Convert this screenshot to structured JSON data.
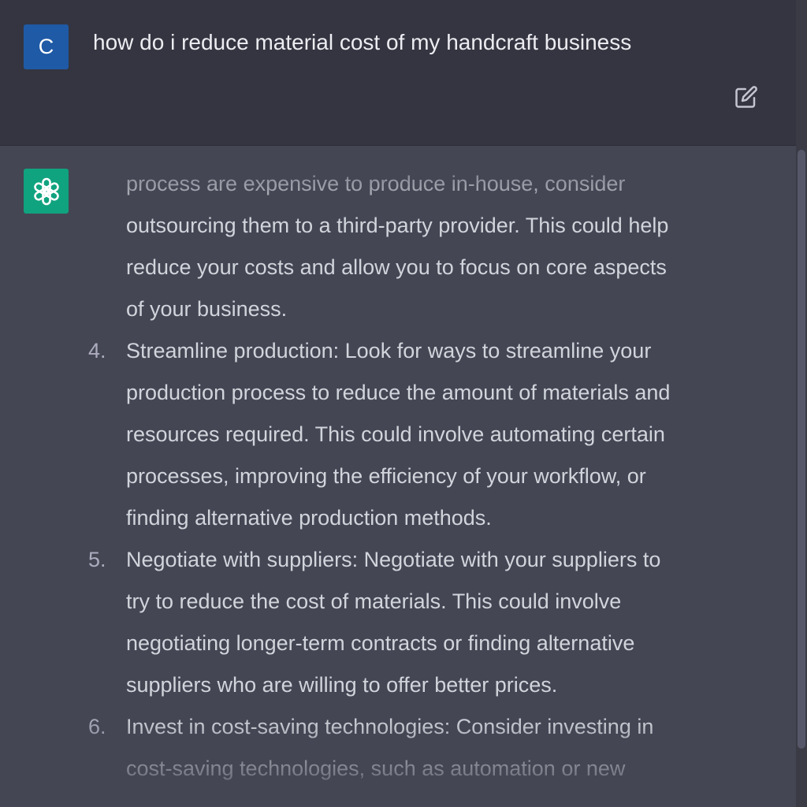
{
  "user": {
    "avatar_letter": "C",
    "message": "how do i reduce material cost of my handcraft business"
  },
  "icons": {
    "edit": "edit-icon",
    "assistant": "openai-logo-icon"
  },
  "colors": {
    "user_bg": "#343541",
    "assistant_bg": "#444654",
    "user_avatar": "#1f5aa6",
    "assistant_avatar": "#10a37f",
    "text": "#d1d5db"
  },
  "answer": {
    "continuation_lines": [
      "process are expensive to produce in-house, consider",
      "outsourcing them to a third-party provider. This could help",
      "reduce your costs and allow you to focus on core aspects",
      "of your business."
    ],
    "items": [
      {
        "number": "4.",
        "lines": [
          "Streamline production: Look for ways to streamline your",
          "production process to reduce the amount of materials and",
          "resources required. This could involve automating certain",
          "processes, improving the efficiency of your workflow, or",
          "finding alternative production methods."
        ]
      },
      {
        "number": "5.",
        "lines": [
          "Negotiate with suppliers: Negotiate with your suppliers to",
          "try to reduce the cost of materials. This could involve",
          "negotiating longer-term contracts or finding alternative",
          "suppliers who are willing to offer better prices."
        ]
      },
      {
        "number": "6.",
        "lines": [
          "Invest in cost-saving technologies: Consider investing in",
          "cost-saving technologies, such as automation or new"
        ]
      }
    ]
  }
}
